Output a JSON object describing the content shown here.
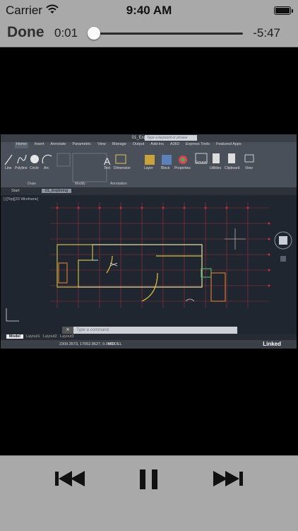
{
  "status_bar": {
    "carrier": "Carrier",
    "time": "9:40 AM",
    "wifi_icon": "wifi-icon",
    "battery_icon": "battery-icon",
    "battery_level": 1.0
  },
  "player": {
    "done_label": "Done",
    "elapsed": "0:01",
    "remaining": "-5:47",
    "progress": 0.004,
    "buttons": {
      "previous": "skip-back-icon",
      "play_pause": "pause-icon",
      "next": "skip-forward-icon"
    }
  },
  "video_frame": {
    "window_title": "01_Exploring.dwg",
    "search_placeholder": "Type a keyword or phrase",
    "ribbon_tabs": [
      "Home",
      "Insert",
      "Annotate",
      "Parametric",
      "View",
      "Manage",
      "Output",
      "Add-ins",
      "A360",
      "Express Tools",
      "Featured Apps"
    ],
    "ribbon_panels": [
      "Draw",
      "Modify",
      "Annotation"
    ],
    "ribbon_tools": [
      "Line",
      "Polyline",
      "Circle",
      "Arc",
      "Text",
      "Dimension",
      "Layer",
      "Block",
      "Properties",
      "Groups",
      "Utilities",
      "Clipboard",
      "View"
    ],
    "doc_tabs": [
      "Start",
      "01_Exploring"
    ],
    "viewport_label": "[-][Top][2D Wireframe]",
    "command_placeholder": "Type a command",
    "layout_tabs": [
      "Model",
      "Layout1",
      "Layout2",
      "Layout3"
    ],
    "coordinates": "2309.3573, 17052.8627, 0.0000",
    "space_mode": "MODEL",
    "brand": "Linked"
  }
}
